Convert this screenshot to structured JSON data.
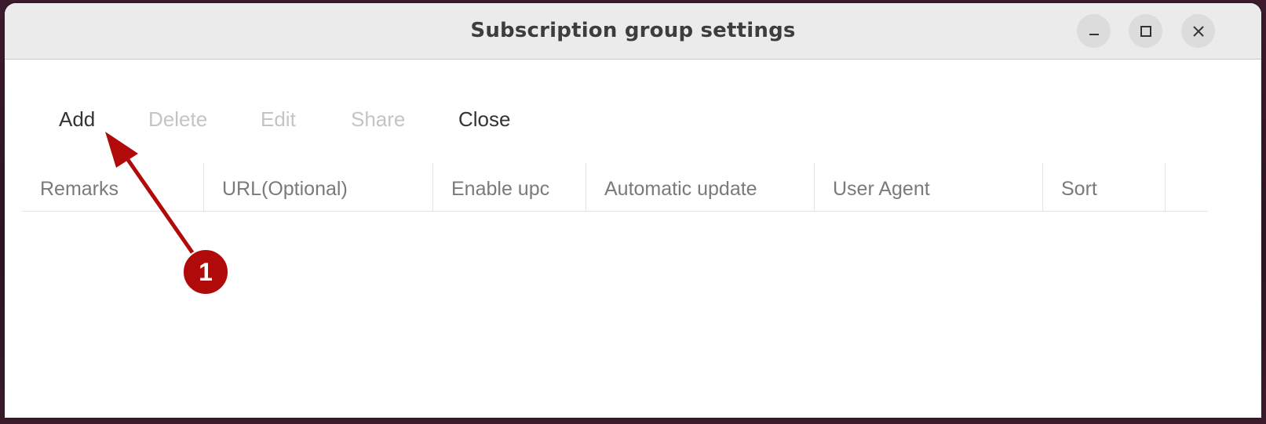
{
  "window": {
    "title": "Subscription group settings",
    "controls": {
      "minimize": "minimize-icon",
      "maximize": "maximize-icon",
      "close": "close-icon"
    }
  },
  "toolbar": {
    "items": [
      {
        "label": "Add",
        "enabled": true
      },
      {
        "label": "Delete",
        "enabled": false
      },
      {
        "label": "Edit",
        "enabled": false
      },
      {
        "label": "Share",
        "enabled": false
      },
      {
        "label": "Close",
        "enabled": true
      }
    ]
  },
  "table": {
    "columns": [
      {
        "label": "Remarks"
      },
      {
        "label": "URL(Optional)"
      },
      {
        "label": "Enable upc"
      },
      {
        "label": "Automatic update"
      },
      {
        "label": "User Agent"
      },
      {
        "label": "Sort"
      },
      {
        "label": ""
      }
    ],
    "rows": []
  },
  "annotation": {
    "badge_number": "1",
    "color": "#b00a0a",
    "target": "Add"
  },
  "colors": {
    "titlebar_bg": "#ebebeb",
    "window_bg": "#ffffff",
    "text_enabled": "#333333",
    "text_disabled": "#c4c4c4",
    "header_text": "#7a7a7a",
    "desktop_bg": "#3a1a2c"
  }
}
